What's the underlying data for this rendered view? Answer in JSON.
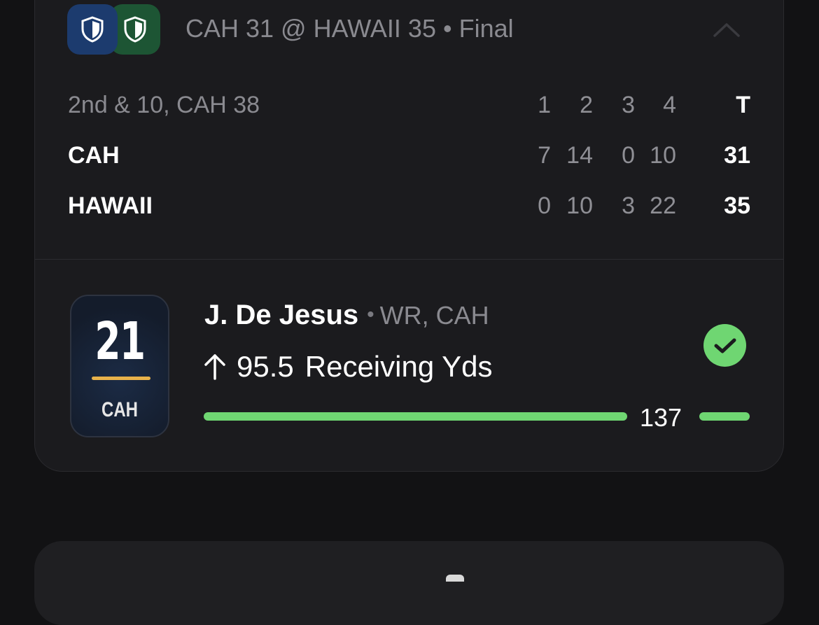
{
  "game": {
    "matchup": "CAH 31 @ HAWAII 35 • Final",
    "away_logo_icon": "shield-icon",
    "home_logo_icon": "shield-icon",
    "away_color": "#1c3b6e",
    "home_color": "#1d5534"
  },
  "scoreboard": {
    "situation": "2nd & 10, CAH 38",
    "headers": [
      "1",
      "2",
      "3",
      "4",
      "T"
    ],
    "rows": [
      {
        "team": "CAH",
        "quarters": [
          "7",
          "14",
          "0",
          "10"
        ],
        "total": "31"
      },
      {
        "team": "HAWAII",
        "quarters": [
          "0",
          "10",
          "3",
          "22"
        ],
        "total": "35"
      }
    ]
  },
  "player": {
    "number": "21",
    "team": "CAH",
    "name": "J. De Jesus",
    "separator": "•",
    "position_team": "WR, CAH",
    "direction_icon": "arrow-up-icon",
    "line": "95.5",
    "stat": "Receiving Yds",
    "result": "137",
    "status_icon": "check-icon",
    "status_color": "#6fd672",
    "accent_color": "#e8b24a"
  }
}
